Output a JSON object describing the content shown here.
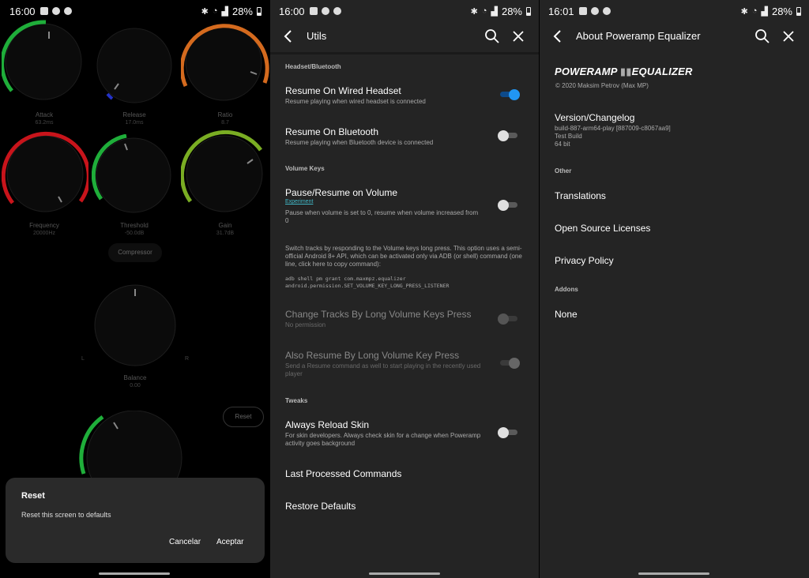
{
  "status_bar": [
    {
      "time": "16:00",
      "battery": "28%"
    },
    {
      "time": "16:00",
      "battery": "28%"
    },
    {
      "time": "16:01",
      "battery": "28%"
    }
  ],
  "compressor": {
    "knobs": [
      {
        "label": "Attack",
        "value": "63.2ms",
        "color": "#1fae3a"
      },
      {
        "label": "Release",
        "value": "17.0ms",
        "color": "#2433c8"
      },
      {
        "label": "Ratio",
        "value": "8.7",
        "color": "#d46a1e"
      },
      {
        "label": "Frequency",
        "value": "20000Hz",
        "color": "#c8141b"
      },
      {
        "label": "Threshold",
        "value": "-50.0dB",
        "color": "#1fae3a"
      },
      {
        "label": "Gain",
        "value": "31.7dB",
        "color": "#7aad23"
      }
    ],
    "compressor_label": "Compressor",
    "balance": {
      "label": "Balance",
      "value": "0.00",
      "left": "L",
      "right": "R"
    },
    "reset_label": "Reset"
  },
  "reset_dialog": {
    "title": "Reset",
    "message": "Reset this screen to defaults",
    "cancel": "Cancelar",
    "accept": "Aceptar"
  },
  "utils": {
    "title": "Utils",
    "sections": {
      "headset": "Headset/Bluetooth",
      "volume_keys": "Volume Keys",
      "tweaks": "Tweaks"
    },
    "resume_wired": {
      "title": "Resume On Wired Headset",
      "subtitle": "Resume playing when wired headset is connected",
      "on": true
    },
    "resume_bt": {
      "title": "Resume On Bluetooth",
      "subtitle": "Resume playing when Bluetooth device is connected",
      "on": false
    },
    "pause_volume": {
      "title": "Pause/Resume on Volume",
      "badge": "Experiment",
      "subtitle": "Pause when volume is set to 0, resume when volume increased from 0",
      "on": false
    },
    "volume_info": "Switch tracks by responding to the Volume keys long press. This option uses a semi-official Android 8+ API, which can be activated only via ADB (or shell) command (one line, click here to copy command):",
    "adb_line1": "adb shell pm grant com.maxmpz.equalizer",
    "adb_line2": "android.permission.SET_VOLUME_KEY_LONG_PRESS_LISTENER",
    "change_tracks": {
      "title": "Change Tracks By Long Volume Keys Press",
      "subtitle": "No permission",
      "on": false
    },
    "also_resume": {
      "title": "Also Resume By Long Volume Key Press",
      "subtitle": "Send a Resume command as well to start playing in the recently used player",
      "on": true
    },
    "reload_skin": {
      "title": "Always Reload Skin",
      "subtitle": "For skin developers. Always check skin for a change when Poweramp activity goes background",
      "on": false
    },
    "last_commands": "Last Processed Commands",
    "restore_defaults": "Restore Defaults"
  },
  "about": {
    "title": "About Poweramp Equalizer",
    "logo_part1": "POWERAMP",
    "logo_part2": "EQUALIZER",
    "copyright": "© 2020 Maksim Petrov (Max MP)",
    "version_title": "Version/Changelog",
    "version_build": "build-887-arm64-play [887009-c8067aa9]",
    "version_type": "Test Build",
    "version_bits": "64 bit",
    "section_other": "Other",
    "translations": "Translations",
    "licenses": "Open Source Licenses",
    "privacy": "Privacy Policy",
    "section_addons": "Addons",
    "addons_none": "None"
  },
  "icons": [
    "back-arrow-icon",
    "search-icon",
    "close-icon",
    "bluetooth-icon",
    "wifi-icon",
    "signal-icon",
    "battery-icon",
    "gallery-icon",
    "notification-icon"
  ]
}
